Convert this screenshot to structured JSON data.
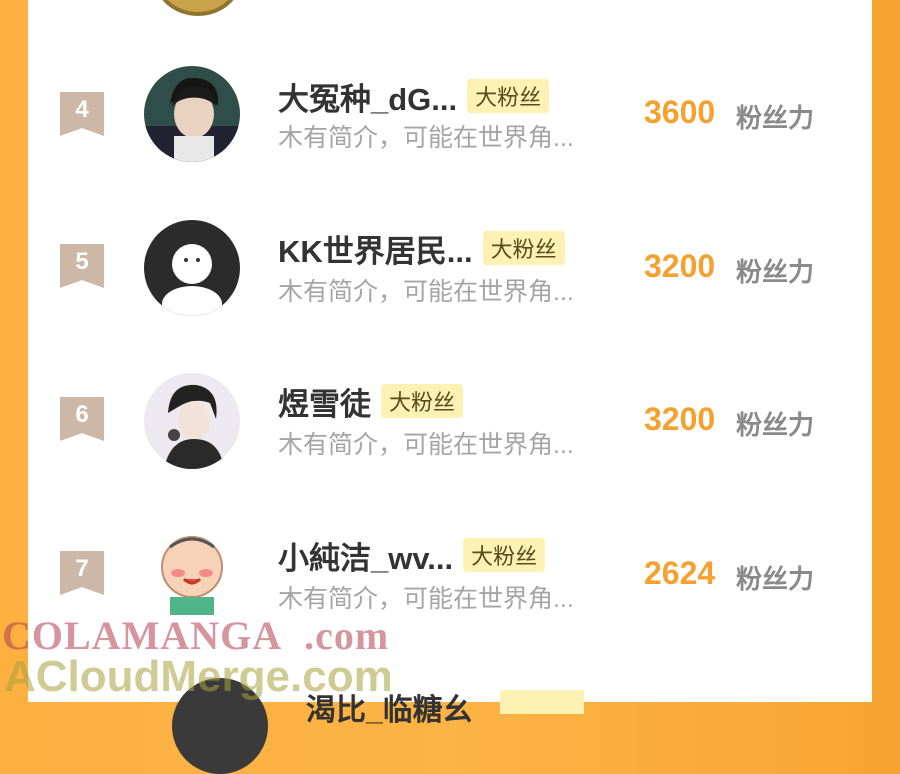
{
  "list": {
    "rows": [
      {
        "rank": "4",
        "name": "大冤种_dG...",
        "badge": "大粉丝",
        "intro": "木有简介，可能在世界角...",
        "score": "3600",
        "unit": "粉丝力"
      },
      {
        "rank": "5",
        "name": "KK世界居民...",
        "badge": "大粉丝",
        "intro": "木有简介，可能在世界角...",
        "score": "3200",
        "unit": "粉丝力"
      },
      {
        "rank": "6",
        "name": "煜雪徒",
        "badge": "大粉丝",
        "intro": "木有简介，可能在世界角...",
        "score": "3200",
        "unit": "粉丝力"
      },
      {
        "rank": "7",
        "name": "小純洁_wv...",
        "badge": "大粉丝",
        "intro": "木有简介，可能在世界角...",
        "score": "2624",
        "unit": "粉丝力"
      }
    ],
    "partial_row_name": "渴比_临糖幺"
  },
  "watermark": {
    "line1_a": "COLA",
    "line1_b": "MANGA",
    "line1_c": ".com",
    "line2": "ACloudMerge.com"
  },
  "colors": {
    "accent": "#f4a130",
    "background": "#fbb040",
    "badge_bg": "#fdf1b3",
    "rank_flag": "#cdb8a8"
  }
}
